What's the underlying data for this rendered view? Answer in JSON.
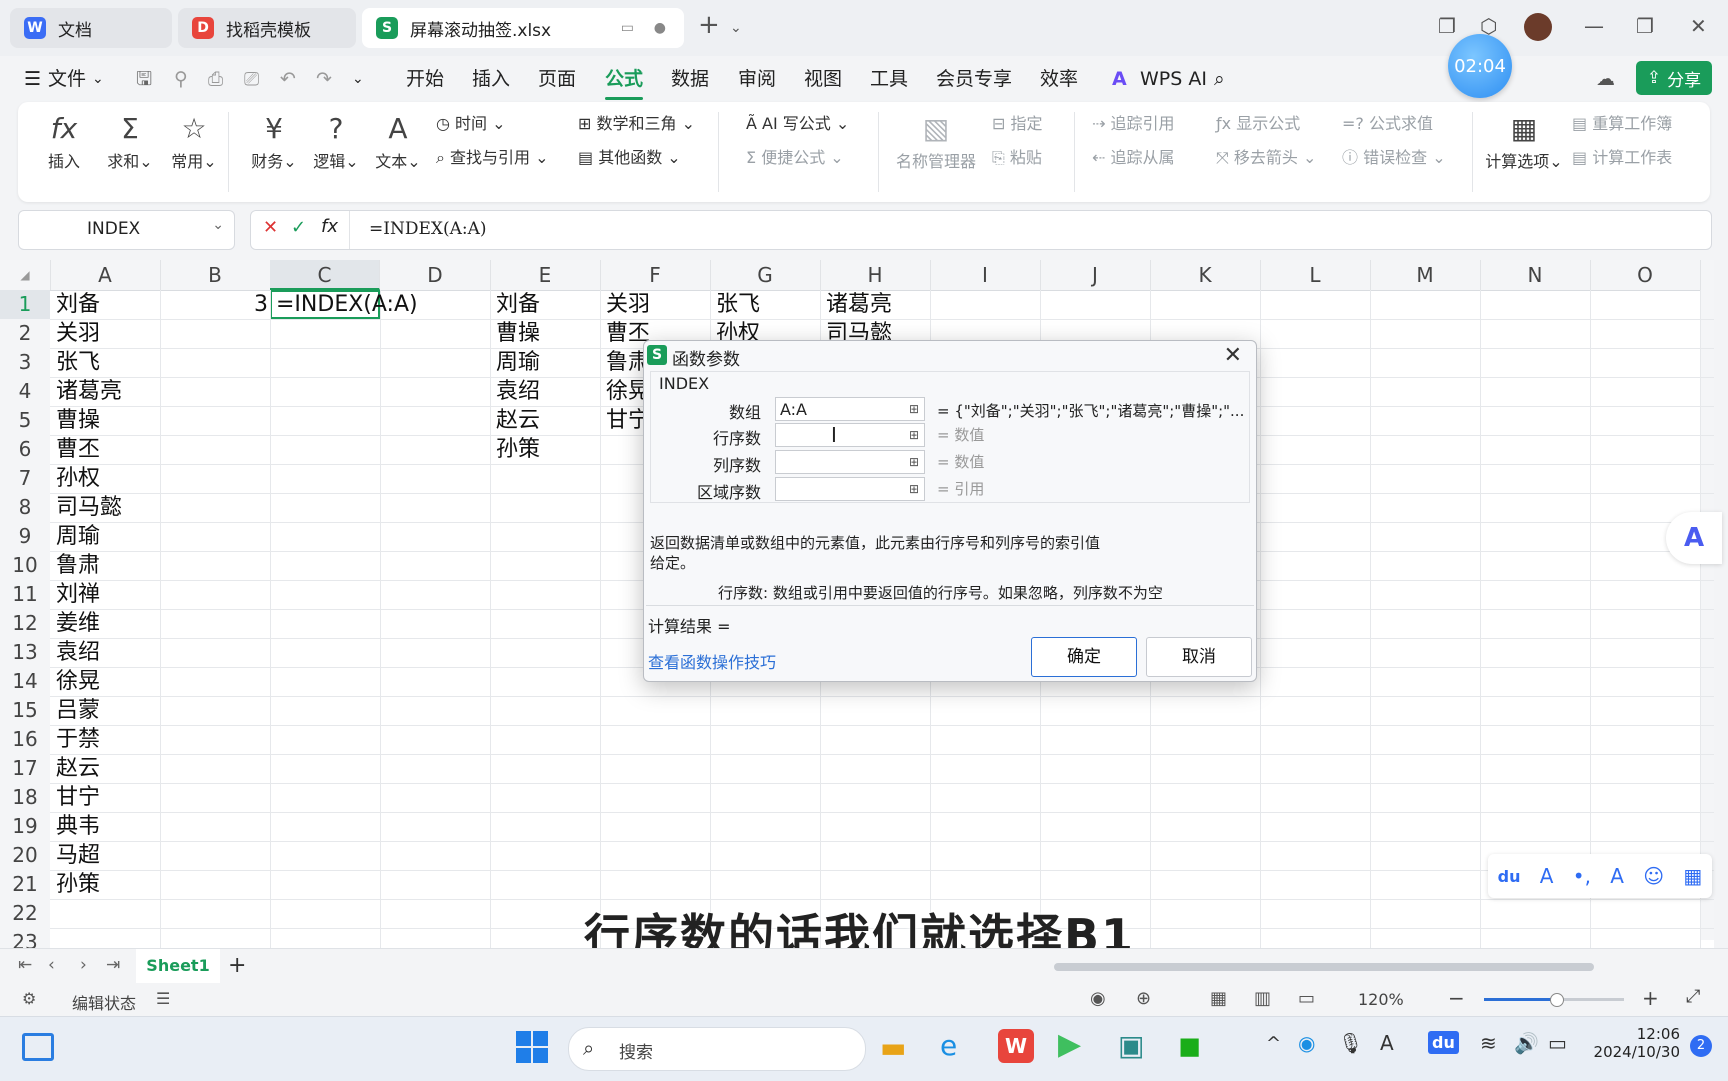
{
  "titlebar": {
    "tabs": [
      {
        "label": "文档",
        "icon": "wps-doc-icon"
      },
      {
        "label": "找稻壳模板",
        "icon": "docer-icon"
      },
      {
        "label": "屏幕滚动抽签.xlsx",
        "icon": "wps-sheet-icon"
      }
    ],
    "new_tab": "+"
  },
  "menubar": {
    "file": "文件",
    "items": [
      "开始",
      "插入",
      "页面",
      "公式",
      "数据",
      "审阅",
      "视图",
      "工具",
      "会员专享",
      "效率"
    ],
    "active": "公式",
    "wps_ai": "WPS AI",
    "share": "分享",
    "timer": "02:04"
  },
  "ribbon": {
    "insert": "插入",
    "sum": "求和",
    "common": "常用",
    "finance": "财务",
    "logic": "逻辑",
    "text": "文本",
    "time": "时间",
    "lookup": "查找与引用",
    "math": "数学和三角",
    "other": "其他函数",
    "ai_formula": "AI 写公式",
    "quick_formula": "便捷公式",
    "name_mgr": "名称管理器",
    "define": "指定",
    "paste": "粘贴",
    "trace_prec": "追踪引用",
    "trace_dep": "追踪从属",
    "show_formula": "显示公式",
    "remove_arrows": "移去箭头",
    "eval_formula": "公式求值",
    "error_check": "错误检查",
    "calc_options": "计算选项",
    "recalc_book": "重算工作簿",
    "calc_sheet": "计算工作表"
  },
  "formulabar": {
    "name": "INDEX",
    "formula": "=INDEX(A:A)"
  },
  "grid": {
    "columns": [
      "A",
      "B",
      "C",
      "D",
      "E",
      "F",
      "G",
      "H",
      "I",
      "J",
      "K",
      "L",
      "M",
      "N",
      "O"
    ],
    "rows": [
      "1",
      "2",
      "3",
      "4",
      "5",
      "6",
      "7",
      "8",
      "9",
      "10",
      "11",
      "12",
      "13",
      "14",
      "15",
      "16",
      "17",
      "18",
      "19",
      "20",
      "21",
      "22",
      "23"
    ],
    "colA": [
      "刘备",
      "关羽",
      "张飞",
      "诸葛亮",
      "曹操",
      "曹丕",
      "孙权",
      "司马懿",
      "周瑜",
      "鲁肃",
      "刘禅",
      "姜维",
      "袁绍",
      "徐晃",
      "吕蒙",
      "于禁",
      "赵云",
      "甘宁",
      "典韦",
      "马超",
      "孙策"
    ],
    "b1": "3",
    "c1": "=INDEX(A:A)",
    "colE": [
      "刘备",
      "曹操",
      "周瑜",
      "袁绍",
      "赵云",
      "孙策"
    ],
    "colF": [
      "关羽",
      "曹丕",
      "鲁肃",
      "徐晃",
      "甘宁"
    ],
    "colG": [
      "张飞",
      "孙权"
    ],
    "colH": [
      "诸葛亮",
      "司马懿"
    ]
  },
  "dialog": {
    "title": "函数参数",
    "function": "INDEX",
    "args": [
      {
        "label": "数组",
        "value": "A:A",
        "result": "= {\"刘备\";\"关羽\";\"张飞\";\"诸葛亮\";\"曹操\";\"..."
      },
      {
        "label": "行序数",
        "value": "",
        "result": "= 数值"
      },
      {
        "label": "列序数",
        "value": "",
        "result": "= 数值"
      },
      {
        "label": "区域序数",
        "value": "",
        "result": "= 引用"
      }
    ],
    "description": "返回数据清单或数组中的元素值，此元素由行序号和列序号的索引值给定。",
    "arg_help": "行序数: 数组或引用中要返回值的行序号。如果忽略，列序数不为空",
    "calc_result": "计算结果 =",
    "help_link": "查看函数操作技巧",
    "ok": "确定",
    "cancel": "取消"
  },
  "subtitle": "行序数的话我们就选择B1",
  "sheets": {
    "active": "Sheet1"
  },
  "status": {
    "mode": "编辑状态",
    "zoom": "120%"
  },
  "taskbar": {
    "search": "搜索",
    "time": "12:06",
    "date": "2024/10/30",
    "notif": "2"
  }
}
